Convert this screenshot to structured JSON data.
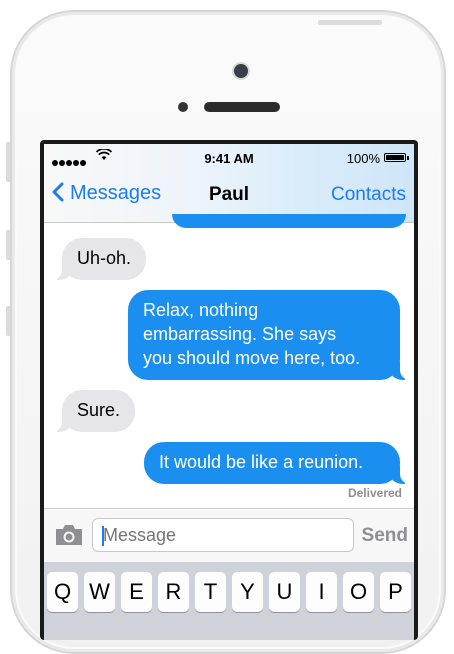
{
  "status_bar": {
    "signal": "●●●●●",
    "time": "9:41 AM",
    "battery_percent": "100%"
  },
  "nav": {
    "back_label": "Messages",
    "title": "Paul",
    "right_label": "Contacts"
  },
  "messages": [
    {
      "direction": "incoming",
      "text": "Uh-oh."
    },
    {
      "direction": "outgoing",
      "lines": [
        "Relax, nothing",
        "embarrassing. She says",
        "you should move here, too."
      ]
    },
    {
      "direction": "incoming",
      "text": "Sure."
    },
    {
      "direction": "outgoing",
      "text": "It would be like a reunion."
    }
  ],
  "delivery_status": "Delivered",
  "composer": {
    "placeholder": "Message",
    "send_label": "Send",
    "camera_icon": "camera-icon"
  },
  "keyboard": {
    "row1": [
      "Q",
      "W",
      "E",
      "R",
      "T",
      "Y",
      "U",
      "I",
      "O",
      "P"
    ]
  },
  "colors": {
    "accent": "#1a7cf0",
    "outgoing_bubble": "#1b8ff0",
    "incoming_bubble": "#e5e5ea"
  }
}
